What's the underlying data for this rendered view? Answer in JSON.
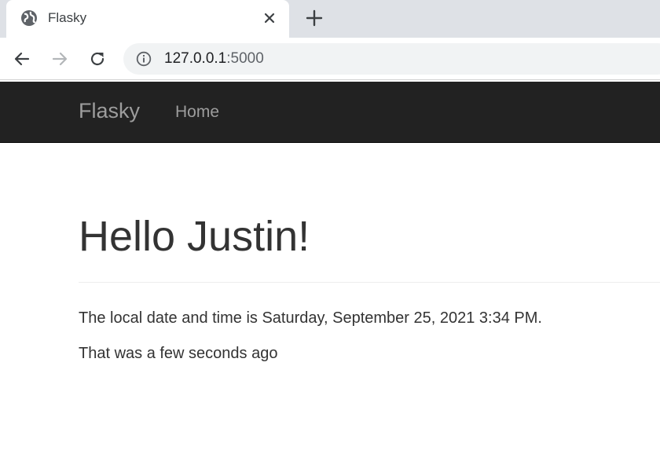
{
  "browser": {
    "tab": {
      "title": "Flasky",
      "favicon": "globe-icon",
      "close_icon": "close-icon"
    },
    "new_tab_icon": "plus-icon",
    "toolbar": {
      "back_icon": "back-arrow-icon",
      "forward_icon": "forward-arrow-icon",
      "reload_icon": "reload-icon",
      "site_info_icon": "info-icon",
      "url_host": "127.0.0.1",
      "url_port": ":5000"
    }
  },
  "navbar": {
    "brand": "Flasky",
    "links": [
      {
        "label": "Home"
      }
    ],
    "background": "#222222",
    "text_color": "#9d9d9d"
  },
  "page": {
    "heading": "Hello Justin!",
    "local_time_line": "The local date and time is Saturday, September 25, 2021 3:34 PM.",
    "relative_time_line": "That was a few seconds ago"
  }
}
